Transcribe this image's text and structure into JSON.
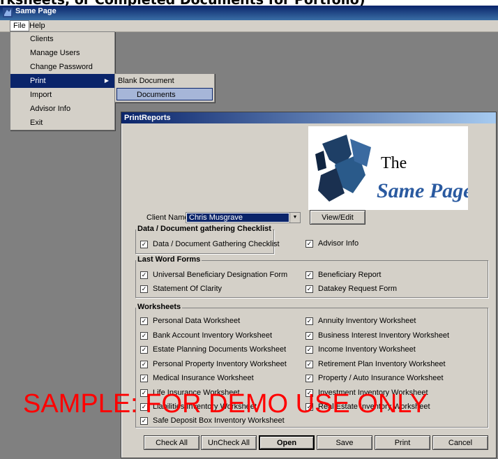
{
  "document_heading": "rksheets, or Completed Documents for Portfolio)",
  "window": {
    "title": "Same Page"
  },
  "menubar": {
    "file": "File",
    "help": "Help"
  },
  "file_menu": {
    "items": [
      {
        "label": "Clients"
      },
      {
        "label": "Manage Users"
      },
      {
        "label": "Change Password"
      },
      {
        "label": "Print"
      },
      {
        "label": "Import"
      },
      {
        "label": "Advisor Info"
      },
      {
        "label": "Exit"
      }
    ]
  },
  "print_submenu": {
    "items": [
      {
        "label": "Blank Document"
      },
      {
        "label": "Documents"
      }
    ]
  },
  "dialog": {
    "title": "PrintReports",
    "logo": {
      "line1": "The",
      "line2": "Same Page"
    },
    "client_label": "Client Name:",
    "client_value": "Chris Musgrave",
    "view_edit": "View/Edit",
    "groups": {
      "data_gathering": {
        "label": "Data / Document gathering Checklist",
        "items": [
          "Data / Document Gathering Checklist"
        ]
      },
      "advisor": "Advisor Info",
      "last_word": {
        "label": "Last Word Forms",
        "left": [
          "Universal Beneficiary Designation Form",
          "Statement Of Clarity"
        ],
        "right": [
          "Beneficiary Report",
          "Datakey Request Form"
        ]
      },
      "worksheets": {
        "label": "Worksheets",
        "left": [
          "Personal Data Worksheet",
          "Bank Account Inventory Worksheet",
          "Estate Planning Documents Worksheet",
          "Personal Property Inventory Worksheet",
          "Medical Insurance Worksheet",
          "Life Insurance Worksheet",
          "Liabilities Inventory Worksheet",
          "Safe Deposit Box Inventory Worksheet"
        ],
        "right": [
          "Annuity Inventory Worksheet",
          "Business Interest Inventory Worksheet",
          "Income Inventory Worksheet",
          "Retirement Plan Inventory Worksheet",
          "Property / Auto Insurance Worksheet",
          "Investment Inventory Worksheet",
          "Real Estate Inventory Worksheet"
        ]
      }
    },
    "buttons": {
      "check_all": "Check All",
      "uncheck_all": "UnCheck All",
      "open": "Open",
      "save": "Save",
      "print": "Print",
      "cancel": "Cancel"
    }
  },
  "watermark": "SAMPLE: FOR DEMO USE ONLY",
  "colors": {
    "titlebar": "#0a246a",
    "selection": "#0a246a",
    "face": "#d4d0c8",
    "watermark": "#ff0000"
  }
}
